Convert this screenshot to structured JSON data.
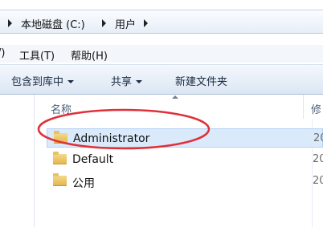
{
  "address": {
    "crumbs": [
      "本地磁盘 (C:)",
      "用户"
    ]
  },
  "menu": {
    "view_fragment": "/)",
    "tools": "工具(T)",
    "help": "帮助(H)"
  },
  "toolbar": {
    "include_library": "包含到库中",
    "share": "共享",
    "new_folder": "新建文件夹"
  },
  "columns": {
    "name": "名称",
    "modified": "修"
  },
  "files": [
    {
      "name": "Administrator",
      "date": "20",
      "selected": true
    },
    {
      "name": "Default",
      "date": "20",
      "selected": false
    },
    {
      "name": "公用",
      "date": "20",
      "selected": false
    }
  ],
  "annotation": {
    "color": "#e0303a"
  }
}
